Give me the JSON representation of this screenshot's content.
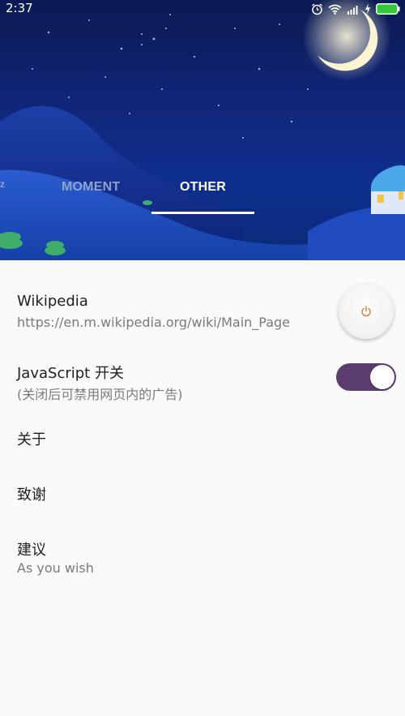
{
  "status_bar": {
    "time": "2:37",
    "icons": [
      "alarm-icon",
      "wifi-icon",
      "signal-icon",
      "charging-icon",
      "battery-icon"
    ]
  },
  "tabs": [
    {
      "label": "MOMENT",
      "selected": false
    },
    {
      "label": "OTHER",
      "selected": true
    }
  ],
  "items": [
    {
      "title": "Wikipedia",
      "subtitle": "https://en.m.wikipedia.org/wiki/Main_Page",
      "control": "power-button"
    },
    {
      "title": "JavaScript 开关",
      "subtitle": "(关闭后可禁用网页内的广告)",
      "control": "toggle",
      "toggle_on": true
    },
    {
      "title": "关于"
    },
    {
      "title": "致谢"
    },
    {
      "title": "建议",
      "subtitle": "As you wish"
    }
  ],
  "colors": {
    "toggle_on": "#5a3d6e",
    "tab_selected": "#ffffff",
    "tab_unselected": "#8ea2cf",
    "power_icon": "#e07a2a",
    "battery": "#35c737"
  }
}
